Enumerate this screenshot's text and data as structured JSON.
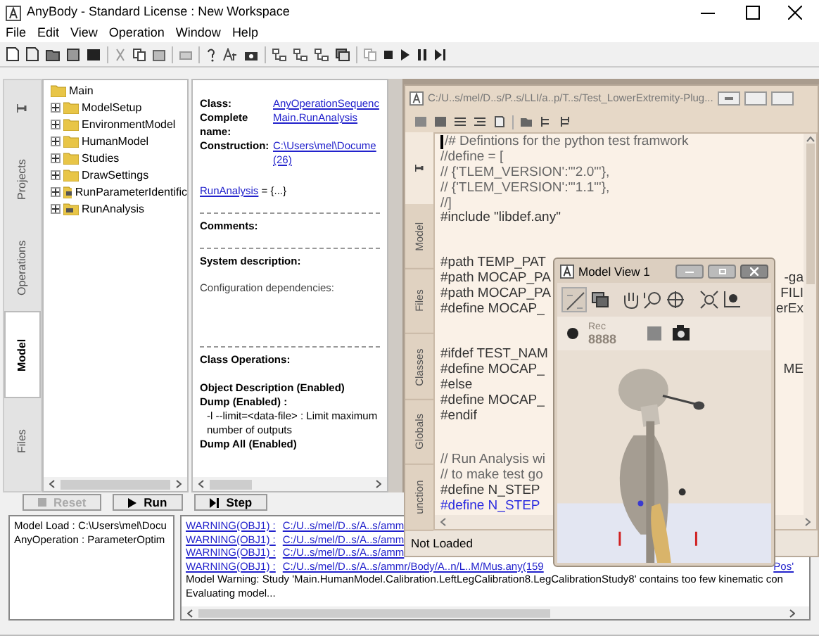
{
  "window": {
    "title": "AnyBody  -  Standard License :  New Workspace"
  },
  "menu": [
    "File",
    "Edit",
    "View",
    "Operation",
    "Window",
    "Help"
  ],
  "left_tabs": [
    {
      "label": "Projects",
      "selected": false
    },
    {
      "label": "Operations",
      "selected": false
    },
    {
      "label": "Model",
      "selected": true
    },
    {
      "label": "Files",
      "selected": false
    }
  ],
  "tree": {
    "label": "Main",
    "children": [
      {
        "label": "ModelSetup",
        "kind": "folder",
        "expanded": false
      },
      {
        "label": "EnvironmentModel",
        "kind": "folder",
        "expanded": false
      },
      {
        "label": "HumanModel",
        "kind": "folder",
        "expanded": false
      },
      {
        "label": "Studies",
        "kind": "folder",
        "expanded": false
      },
      {
        "label": "DrawSettings",
        "kind": "folder",
        "expanded": false
      },
      {
        "label": "RunParameterIdentific",
        "kind": "operation",
        "expanded": false
      },
      {
        "label": "RunAnalysis",
        "kind": "operation",
        "expanded": false
      }
    ]
  },
  "info": {
    "fields": [
      {
        "label": "Class:",
        "values": [
          "AnyOperationSequenc"
        ]
      },
      {
        "label": "Complete name:",
        "values": [
          "Main.RunAnalysis"
        ]
      },
      {
        "label": "Construction:",
        "values": [
          "C:\\Users\\mel\\Docume",
          "(26)"
        ]
      }
    ],
    "member_link": "RunAnalysis",
    "member_rest": " = {...}",
    "comments_heading": "Comments:",
    "system_heading": "System description:",
    "config_text": "Configuration dependencies:",
    "class_ops_heading": "Class Operations:",
    "ops": [
      {
        "kind": "bold",
        "text": "Object Description (Enabled)"
      },
      {
        "kind": "bold",
        "text": "Dump (Enabled) :"
      },
      {
        "kind": "plain",
        "text": "-l --limit=<data-file> : Limit maximum number of outputs"
      },
      {
        "kind": "bold",
        "text": "Dump All (Enabled)"
      }
    ]
  },
  "editor": {
    "title": "C:/U..s/mel/D..s/P..s/LLI/a..p/T..s/Test_LowerExtremity-Plug...",
    "tabs": [
      {
        "label": "Model",
        "selected": false
      },
      {
        "label": "Files",
        "selected": false
      },
      {
        "label": "Classes",
        "selected": false
      },
      {
        "label": "Globals",
        "selected": false
      },
      {
        "label": "unction",
        "selected": false
      }
    ],
    "code": [
      {
        "kind": "comment",
        "text": "/# Defintions for the python test framwork"
      },
      {
        "kind": "comment",
        "text": "//define = ["
      },
      {
        "kind": "comment",
        "text": "//  {'TLEM_VERSION':'\"2.0\"'},"
      },
      {
        "kind": "comment",
        "text": "//  {'TLEM_VERSION':'\"1.1\"'},"
      },
      {
        "kind": "comment",
        "text": "//]"
      },
      {
        "kind": "code",
        "text": "#include \"libdef.any\""
      },
      {
        "kind": "blank"
      },
      {
        "kind": "blank"
      },
      {
        "kind": "code",
        "text": "#path TEMP_PAT"
      },
      {
        "kind": "code",
        "text": "#path MOCAP_PA",
        "right": "-ga"
      },
      {
        "kind": "code",
        "text": "#path MOCAP_PA",
        "right": "FILI"
      },
      {
        "kind": "code",
        "text": "#define MOCAP_",
        "right": "erEx"
      },
      {
        "kind": "blank"
      },
      {
        "kind": "blank"
      },
      {
        "kind": "code",
        "text": "#ifdef TEST_NAM"
      },
      {
        "kind": "code",
        "text": "#define  MOCAP_",
        "right": "ME"
      },
      {
        "kind": "code",
        "text": "#else"
      },
      {
        "kind": "code",
        "text": "#define  MOCAP_"
      },
      {
        "kind": "code",
        "text": "#endif"
      },
      {
        "kind": "blank"
      },
      {
        "kind": "blank"
      },
      {
        "kind": "comment",
        "text": "// Run Analysis wi"
      },
      {
        "kind": "comment",
        "text": "// to make test go"
      },
      {
        "kind": "code",
        "text": "#define N_STEP"
      },
      {
        "kind": "link",
        "text": "#define N_STEP"
      }
    ],
    "status": "Not Loaded"
  },
  "model_view": {
    "title": "Model View 1",
    "rec_label": "Rec",
    "rec_counter": "8888",
    "recording_enabled": false
  },
  "controls": [
    {
      "label": "Reset",
      "disabled": true
    },
    {
      "label": "Run",
      "disabled": false
    },
    {
      "label": "Step",
      "disabled": false
    }
  ],
  "log_left": [
    "Model Load : C:\\Users\\mel\\Docu",
    "AnyOperation : ParameterOptim"
  ],
  "messages": [
    {
      "kind": "warning",
      "tag": "WARNING(OBJ1) :",
      "path": "C:/U..s/mel/D..s/A..s/amm"
    },
    {
      "kind": "warning",
      "tag": "WARNING(OBJ1) :",
      "path": "C:/U..s/mel/D..s/A..s/amm"
    },
    {
      "kind": "warning",
      "tag": "WARNING(OBJ1) :",
      "path": "C:/U..s/mel/D..s/A..s/amm"
    },
    {
      "kind": "warning",
      "tag": "WARNING(OBJ1) :",
      "path": "C:/U..s/mel/D..s/A..s/ammr/Body/A..n/L..M/Mus.any(159",
      "tail": "Pos'"
    },
    {
      "kind": "text",
      "text": "Model Warning: Study 'Main.HumanModel.Calibration.LeftLegCalibration8.LegCalibrationStudy8'  contains too few kinematic con"
    },
    {
      "kind": "text",
      "text": "Evaluating model..."
    }
  ]
}
